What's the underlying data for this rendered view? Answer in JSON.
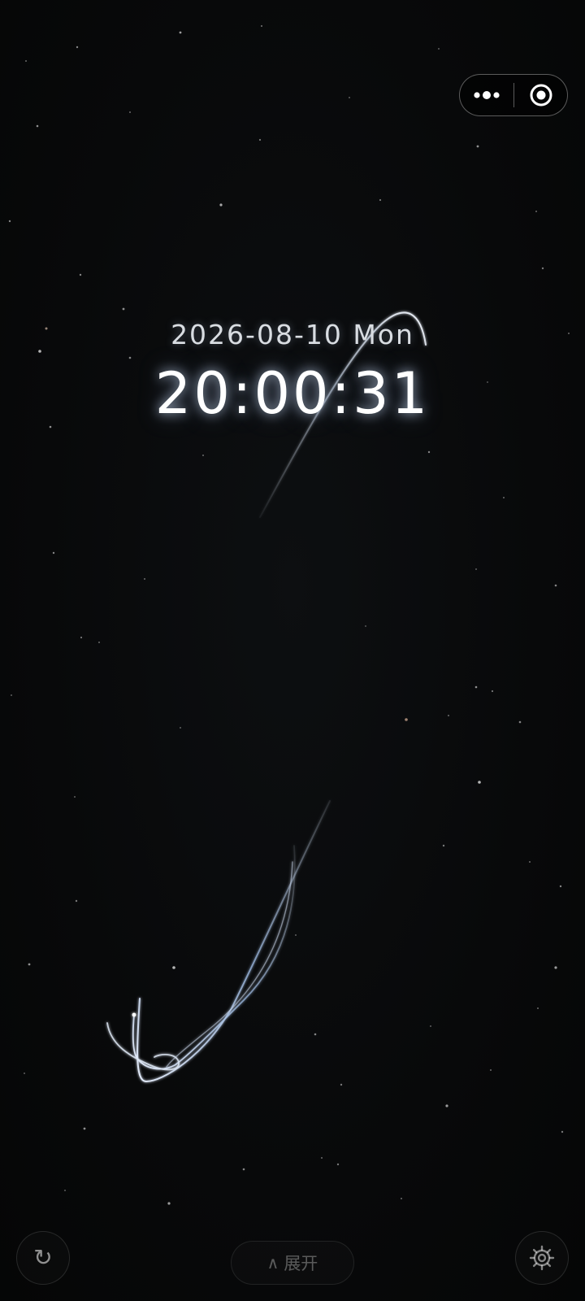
{
  "clock": {
    "date": "2026-08-10 Mon",
    "time": "20:00:31"
  },
  "capsule": {
    "more_icon": "more-dots-icon",
    "close_icon": "target-close-icon"
  },
  "bottom_bar": {
    "refresh_icon": "refresh-icon",
    "refresh_glyph": "↻",
    "expand_caret": "∧",
    "expand_label": "展开",
    "settings_icon": "gear-icon"
  },
  "colors": {
    "background": "#08090a",
    "trail_light": "#e8f0ff",
    "trail_blue": "#8fb4e8"
  }
}
